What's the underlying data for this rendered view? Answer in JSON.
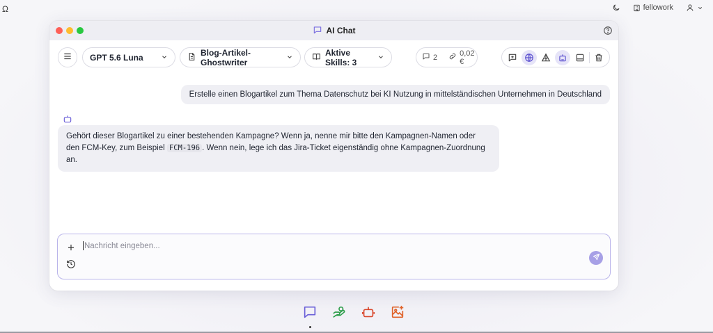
{
  "system_bar": {
    "left_glyph": "Ω",
    "workspace_label": "fellowork"
  },
  "window": {
    "title": "AI Chat"
  },
  "toolbar": {
    "model": "GPT 5.6 Luna",
    "assistant": "Blog-Artikel-Ghostwriter",
    "skills": "Aktive Skills: 3",
    "message_count": "2",
    "cost": "0,02 €"
  },
  "conversation": {
    "user_message": "Erstelle einen Blogartikel zum Thema Datenschutz bei KI Nutzung in mittelständischen Unternehmen in Deutschland",
    "bot_message": {
      "part1": "Gehört dieser Blogartikel zu einer bestehenden Kampagne? Wenn ja, nenne mir bitte den Kampagnen-Namen oder den FCM-Key, zum Beispiel ",
      "code": "FCM-196",
      "part2": ". Wenn nein, lege ich das Jira-Ticket eigenständig ohne Kampagnen-Zuordnung an."
    }
  },
  "composer": {
    "placeholder": "Nachricht eingeben..."
  },
  "colors": {
    "accent": "#7b6fe0",
    "dock_chat": "#6a5fd8",
    "dock_hand": "#2e9e4b",
    "dock_bot": "#d9462b",
    "dock_image": "#e0632a"
  },
  "icons": {
    "system": [
      "moon-icon",
      "building-icon",
      "user-icon",
      "chevron-down-icon"
    ],
    "toolbar": [
      "menu-icon",
      "document-icon",
      "book-icon",
      "chat-icon",
      "link-icon",
      "message-plus-icon",
      "globe-icon",
      "triangle-ruler-icon",
      "robot-icon",
      "panel-icon",
      "trash-icon"
    ],
    "dock": [
      "chat-icon",
      "hand-coin-icon",
      "robot-icon",
      "image-plus-icon"
    ]
  }
}
